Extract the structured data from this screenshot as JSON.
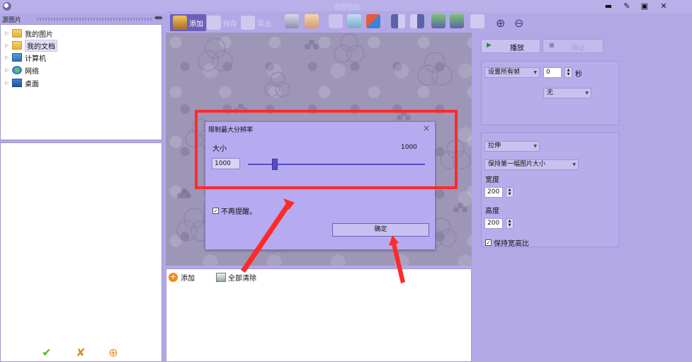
{
  "window": {
    "title": "图图图图",
    "minimize": "▬",
    "edit": "✎",
    "maximize": "▣",
    "close": "✕"
  },
  "left_panel": {
    "title": "源图片",
    "pin": "ᚓ",
    "tree": [
      {
        "label": "我的图片",
        "icon": "folder-icon",
        "selected": false
      },
      {
        "label": "我的文档",
        "icon": "folder-icon",
        "selected": true
      },
      {
        "label": "计算机",
        "icon": "computer-icon",
        "selected": false
      },
      {
        "label": "网络",
        "icon": "network-icon",
        "selected": false
      },
      {
        "label": "桌面",
        "icon": "desktop-icon",
        "selected": false
      }
    ],
    "bottom_buttons": [
      {
        "icon": "check-icon",
        "glyph": "✔",
        "color": "#5bb52e"
      },
      {
        "icon": "check-cross-icon",
        "glyph": "✘",
        "color": "#d9902f"
      },
      {
        "icon": "add-circle-icon",
        "glyph": "⊕",
        "color": "#f08a1c"
      }
    ]
  },
  "toolbar": {
    "add_label": "添加",
    "save_label": "保存",
    "export_label": "导出"
  },
  "list_panel": {
    "add_label": "添加",
    "clear_all_label": "全部清除"
  },
  "right_panel": {
    "play_label": "播放",
    "stop_label": "停止",
    "frame_setting": "设置所有帧",
    "frame_value": "0",
    "seconds_label": "秒",
    "transition_value": "无",
    "stretch_value": "拉伸",
    "size_mode_value": "保持第一幅图片大小",
    "width_label": "宽度",
    "width_value": "200",
    "height_label": "高度",
    "height_value": "200",
    "keep_ratio_label": "保持宽高比",
    "keep_ratio_checked": true
  },
  "dialog": {
    "title": "限制最大分辨率",
    "size_label": "大小",
    "size_display": "1000",
    "size_input": "1000",
    "slider_value_fraction": 0.15,
    "dont_remind_label": "不再提醒。",
    "dont_remind_checked": true,
    "ok_label": "确定",
    "close_glyph": "×"
  },
  "colors": {
    "annotation_red": "#ff2a2a",
    "accent_purple": "#5a4cc4"
  }
}
